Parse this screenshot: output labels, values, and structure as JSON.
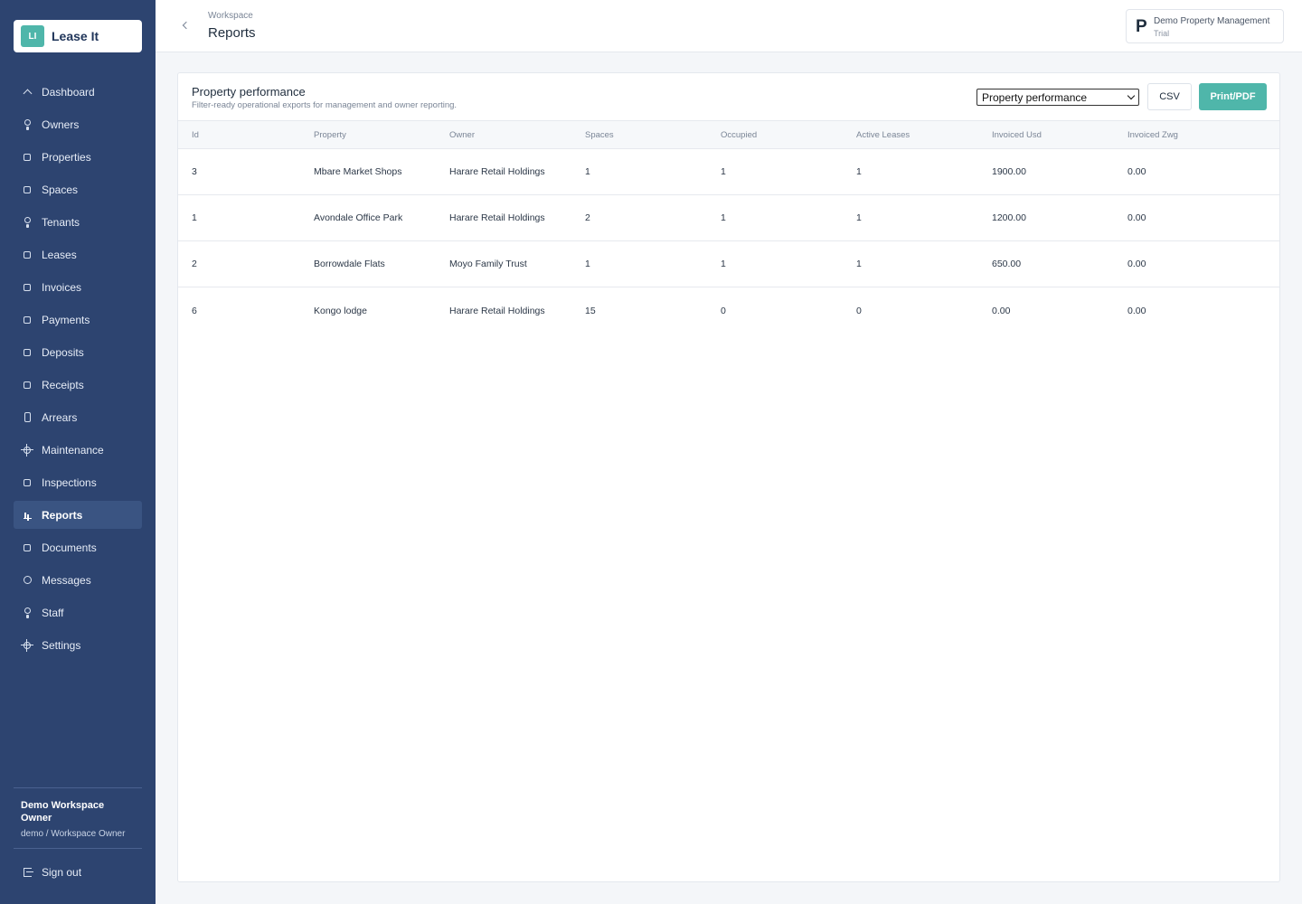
{
  "app": {
    "logo_mark": "LI",
    "name": "Lease It"
  },
  "sidebar": {
    "items": [
      {
        "label": "Dashboard",
        "icon": "chevron-up-icon"
      },
      {
        "label": "Owners",
        "icon": "person-icon"
      },
      {
        "label": "Properties",
        "icon": "square-icon"
      },
      {
        "label": "Spaces",
        "icon": "square-icon"
      },
      {
        "label": "Tenants",
        "icon": "person-icon"
      },
      {
        "label": "Leases",
        "icon": "square-icon"
      },
      {
        "label": "Invoices",
        "icon": "square-icon"
      },
      {
        "label": "Payments",
        "icon": "square-icon"
      },
      {
        "label": "Deposits",
        "icon": "square-icon"
      },
      {
        "label": "Receipts",
        "icon": "square-icon"
      },
      {
        "label": "Arrears",
        "icon": "phone-icon"
      },
      {
        "label": "Maintenance",
        "icon": "gear-icon"
      },
      {
        "label": "Inspections",
        "icon": "square-icon"
      },
      {
        "label": "Reports",
        "icon": "bar-chart-icon",
        "active": true
      },
      {
        "label": "Documents",
        "icon": "square-icon"
      },
      {
        "label": "Messages",
        "icon": "message-icon"
      },
      {
        "label": "Staff",
        "icon": "person-icon"
      },
      {
        "label": "Settings",
        "icon": "gear-icon"
      }
    ],
    "user": {
      "name": "Demo Workspace Owner",
      "role": "demo / Workspace Owner"
    },
    "sign_out": "Sign out"
  },
  "header": {
    "breadcrumb": "Workspace",
    "title": "Reports",
    "workspace": {
      "letter": "P",
      "name": "Demo Property Management",
      "plan": "Trial"
    }
  },
  "report": {
    "title": "Property performance",
    "subtitle": "Filter-ready operational exports for management and owner reporting.",
    "selected_report": "Property performance",
    "csv_label": "CSV",
    "print_label": "Print/PDF",
    "columns": [
      "Id",
      "Property",
      "Owner",
      "Spaces",
      "Occupied",
      "Active Leases",
      "Invoiced Usd",
      "Invoiced Zwg"
    ],
    "rows": [
      [
        "3",
        "Mbare Market Shops",
        "Harare Retail Holdings",
        "1",
        "1",
        "1",
        "1900.00",
        "0.00"
      ],
      [
        "1",
        "Avondale Office Park",
        "Harare Retail Holdings",
        "2",
        "1",
        "1",
        "1200.00",
        "0.00"
      ],
      [
        "2",
        "Borrowdale Flats",
        "Moyo Family Trust",
        "1",
        "1",
        "1",
        "650.00",
        "0.00"
      ],
      [
        "6",
        "Kongo lodge",
        "Harare Retail Holdings",
        "15",
        "0",
        "0",
        "0.00",
        "0.00"
      ]
    ]
  },
  "colors": {
    "sidebar_bg": "#2d4470",
    "sidebar_active": "#3a5482",
    "accent": "#4fb6aa"
  }
}
